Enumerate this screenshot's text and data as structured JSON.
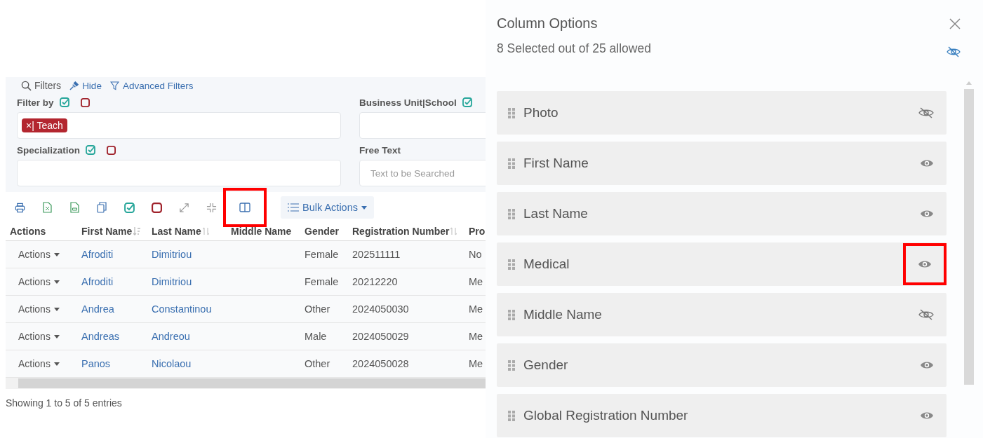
{
  "filters": {
    "legend": "Filters",
    "hide_link": "Hide",
    "advanced_link": "Advanced Filters",
    "fields": [
      {
        "label": "Filter by",
        "kind": "tags",
        "tags": [
          "×| Teach"
        ],
        "toggles": true
      },
      {
        "label": "Business Unit|School",
        "kind": "tags",
        "toggles": true
      },
      {
        "label": "Specialization",
        "kind": "tags",
        "toggles": true
      },
      {
        "label": "Free Text",
        "kind": "text",
        "placeholder": "Text to be Searched",
        "toggles": false
      }
    ]
  },
  "toolbar": [
    {
      "kind": "print",
      "highlighted": false
    },
    {
      "kind": "excel",
      "highlighted": false
    },
    {
      "kind": "csv",
      "highlighted": false
    },
    {
      "kind": "copy",
      "highlighted": false
    },
    {
      "kind": "select-all",
      "highlighted": false
    },
    {
      "kind": "deselect",
      "highlighted": false
    },
    {
      "kind": "expand",
      "highlighted": false
    },
    {
      "kind": "collapse",
      "highlighted": false
    },
    {
      "kind": "columns",
      "highlighted": true
    }
  ],
  "bulk_actions": "Bulk Actions",
  "table": {
    "columns": [
      {
        "label": "Actions",
        "sortable": false
      },
      {
        "label": "First Name",
        "sortable": true,
        "sorted": true
      },
      {
        "label": "Last Name",
        "sortable": true,
        "sorted": false
      },
      {
        "label": "Middle Name",
        "sortable": false
      },
      {
        "label": "Gender",
        "sortable": false
      },
      {
        "label": "Registration Number",
        "sortable": true,
        "sorted": false
      },
      {
        "label": "Pro",
        "sortable": false
      }
    ],
    "rows": [
      {
        "actions": "Actions",
        "first": "Afroditi",
        "last": "Dimitriou",
        "gender": "Female",
        "reg": "202511111",
        "col7": "No"
      },
      {
        "actions": "Actions",
        "first": "Afroditi",
        "last": "Dimitriou",
        "gender": "Female",
        "reg": "20212220",
        "col7": "Me"
      },
      {
        "actions": "Actions",
        "first": "Andrea",
        "last": "Constantinou",
        "gender": "Other",
        "reg": "2024050030",
        "col7": "Me"
      },
      {
        "actions": "Actions",
        "first": "Andreas",
        "last": "Andreou",
        "gender": "Male",
        "reg": "2024050029",
        "col7": "Me"
      },
      {
        "actions": "Actions",
        "first": "Panos",
        "last": "Nicolaou",
        "gender": "Other",
        "reg": "2024050028",
        "col7": "Me"
      }
    ]
  },
  "table_info": "Showing 1 to 5 of 5 entries",
  "column_options": {
    "title": "Column Options",
    "subtitle": "8 Selected out of 25 allowed",
    "items": [
      {
        "label": "Photo",
        "visible": false,
        "highlighted": false
      },
      {
        "label": "First Name",
        "visible": true,
        "highlighted": false
      },
      {
        "label": "Last Name",
        "visible": true,
        "highlighted": false
      },
      {
        "label": "Medical",
        "visible": true,
        "highlighted": true
      },
      {
        "label": "Middle Name",
        "visible": false,
        "highlighted": false
      },
      {
        "label": "Gender",
        "visible": true,
        "highlighted": false
      },
      {
        "label": "Global Registration Number",
        "visible": true,
        "highlighted": false
      }
    ]
  }
}
